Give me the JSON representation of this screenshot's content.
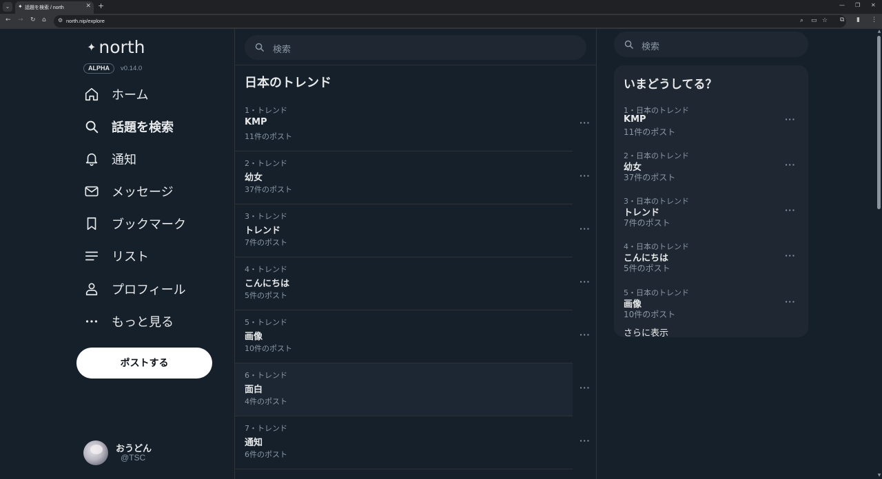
{
  "browser": {
    "tab_title": "話題を検索 / north",
    "url": "north.nip/explore",
    "new_tab": "+",
    "tab_close": "✕",
    "win_min": "—",
    "win_max": "❐",
    "win_close": "✕"
  },
  "sidebar": {
    "logo_text": "north",
    "badge": "ALPHA",
    "version": "v0.14.0",
    "nav": [
      {
        "label": "ホーム",
        "icon": "home-icon"
      },
      {
        "label": "話題を検索",
        "icon": "search-icon",
        "active": true
      },
      {
        "label": "通知",
        "icon": "bell-icon"
      },
      {
        "label": "メッセージ",
        "icon": "mail-icon"
      },
      {
        "label": "ブックマーク",
        "icon": "bookmark-icon"
      },
      {
        "label": "リスト",
        "icon": "list-icon"
      },
      {
        "label": "プロフィール",
        "icon": "person-icon"
      },
      {
        "label": "もっと見る",
        "icon": "more-icon"
      }
    ],
    "post_button": "ポストする",
    "account": {
      "name": "おうどん",
      "handle": "@TSC"
    }
  },
  "main": {
    "search_placeholder": "検索",
    "title": "日本のトレンド",
    "trends": [
      {
        "meta": "1・トレンド",
        "name": "KMP",
        "count": "11件のポスト"
      },
      {
        "meta": "2・トレンド",
        "name": "幼女",
        "count": "37件のポスト"
      },
      {
        "meta": "3・トレンド",
        "name": "トレンド",
        "count": "7件のポスト"
      },
      {
        "meta": "4・トレンド",
        "name": "こんにちは",
        "count": "5件のポスト"
      },
      {
        "meta": "5・トレンド",
        "name": "画像",
        "count": "10件のポスト"
      },
      {
        "meta": "6・トレンド",
        "name": "面白",
        "count": "4件のポスト"
      },
      {
        "meta": "7・トレンド",
        "name": "通知",
        "count": "6件のポスト"
      }
    ],
    "more_glyph": "···"
  },
  "right": {
    "search_placeholder": "検索",
    "panel_title": "いまどうしてる？",
    "trends": [
      {
        "meta": "1・日本のトレンド",
        "name": "KMP",
        "count": "11件のポスト"
      },
      {
        "meta": "2・日本のトレンド",
        "name": "幼女",
        "count": "37件のポスト"
      },
      {
        "meta": "3・日本のトレンド",
        "name": "トレンド",
        "count": "7件のポスト"
      },
      {
        "meta": "4・日本のトレンド",
        "name": "こんにちは",
        "count": "5件のポスト"
      },
      {
        "meta": "5・日本のトレンド",
        "name": "画像",
        "count": "10件のポスト"
      }
    ],
    "show_more": "さらに表示"
  }
}
